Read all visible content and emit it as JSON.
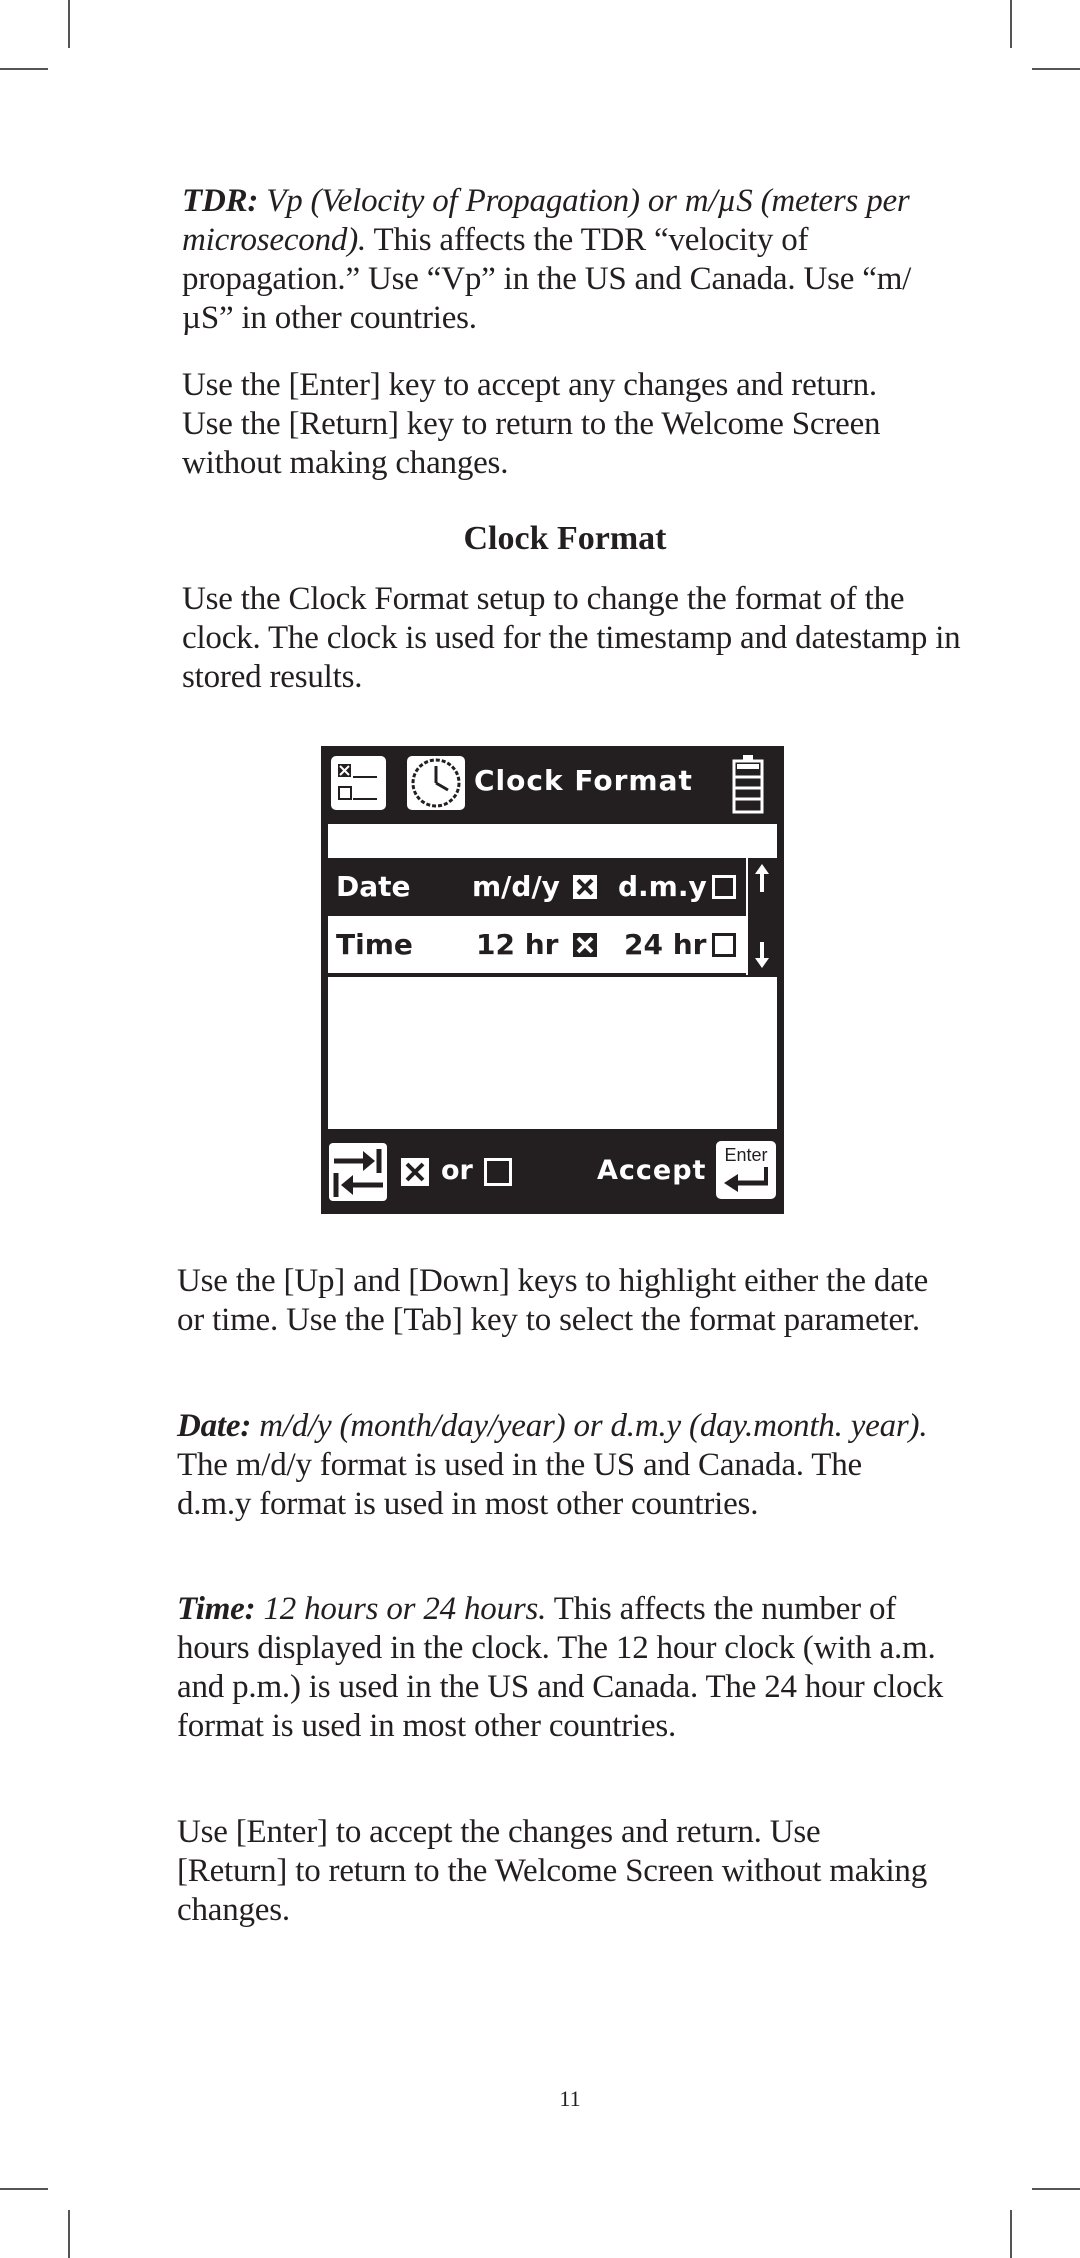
{
  "page": {
    "number": "11"
  },
  "sections": {
    "tdr": {
      "term": "TDR:",
      "definition": " Vp (Velocity of Propagation) or m/µS (meters per microsecond).",
      "body": "  This affects the TDR “velocity of propagation.”  Use “Vp” in the US and Canada. Use “m/µS” in other countries."
    },
    "enter_return_note": "Use the [Enter] key to accept any changes and return. Use the [Return] key to return to the Welcome Screen without making changes.",
    "clock_heading": "Clock Format",
    "clock_intro": "Use the Clock Format setup to change the format of the clock. The clock is used for the timestamp and datestamp in stored results.",
    "keys_note": "Use the [Up] and [Down] keys to highlight either the date or time. Use the [Tab] key to select the format parameter.",
    "date": {
      "term": "Date:",
      "definition": " m/d/y (month/day/year) or d.m.y (day.month. year).",
      "body": " The m/d/y format is used in the US and Canada. The d.m.y format is used in most other countries."
    },
    "time": {
      "term": "Time:",
      "definition": " 12 hours or 24 hours.",
      "body": " This affects the number of hours displayed in the clock. The 12 hour clock (with a.m. and p.m.) is used in the US and Canada. The 24 hour clock format is used in most other countries."
    },
    "final_note": "Use [Enter] to accept the changes and return. Use [Return] to return to the Welcome Screen without making changes."
  },
  "device_screen": {
    "title": "Clock Format",
    "header_icons": [
      "checklist-menu-icon",
      "clock-icon",
      "battery-icon"
    ],
    "rows": [
      {
        "label": "Date",
        "option1": "m/d/y",
        "option1_checked": true,
        "option2": "d.m.y",
        "option2_checked": false,
        "highlighted": true
      },
      {
        "label": "Time",
        "option1": "12 hr",
        "option1_checked": true,
        "option2": "24 hr",
        "option2_checked": false,
        "highlighted": false
      }
    ],
    "scroll_icons": [
      "arrow-up-icon",
      "arrow-down-icon"
    ],
    "footer": {
      "or_label": "or",
      "accept_label": "Accept",
      "enter_key_label": "Enter"
    }
  }
}
